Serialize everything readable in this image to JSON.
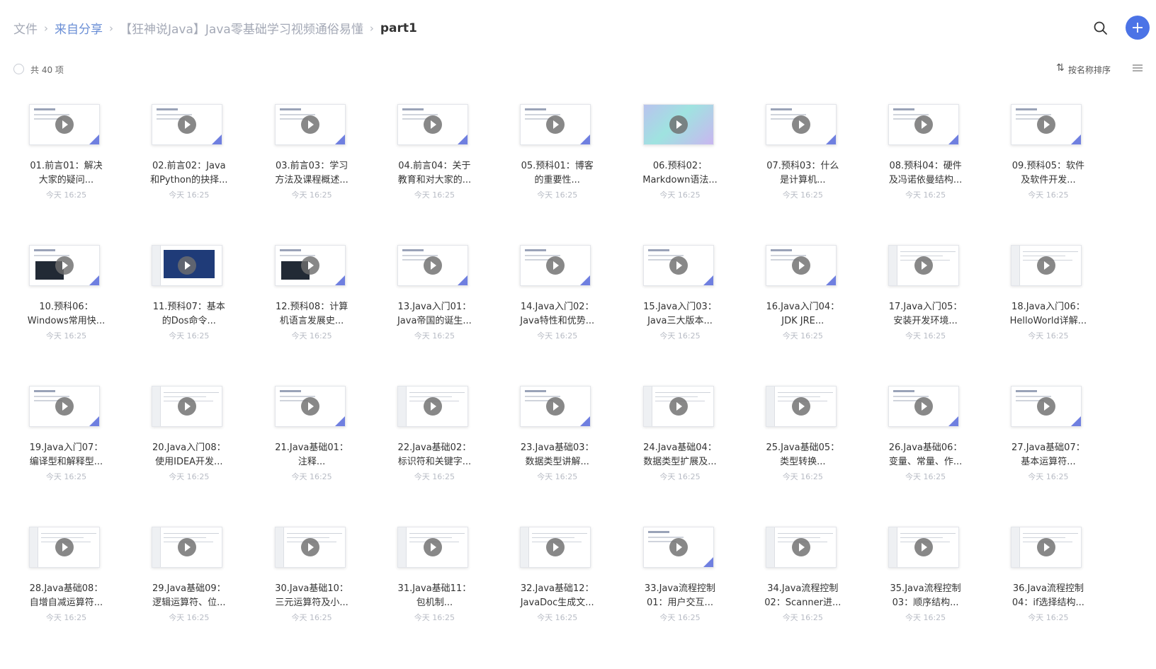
{
  "breadcrumb": [
    "文件",
    "来自分享",
    "【狂神说Java】Java零基础学习视频通俗易懂",
    "part1"
  ],
  "toolbar": {
    "search_icon": "search-icon",
    "add_icon": "plus-icon",
    "add_label": "+"
  },
  "subbar": {
    "count": "共 40 项",
    "sort_label": "按名称排序",
    "sort_icon": "⇅"
  },
  "files": [
    {
      "line1": "01.前言01：解决",
      "line2": "大家的疑问...",
      "date": "今天 16:25",
      "thumb": "slide"
    },
    {
      "line1": "02.前言02：Java",
      "line2": "和Python的抉择...",
      "date": "今天 16:25",
      "thumb": "slide"
    },
    {
      "line1": "03.前言03：学习",
      "line2": "方法及课程概述...",
      "date": "今天 16:25",
      "thumb": "slide"
    },
    {
      "line1": "04.前言04：关于",
      "line2": "教育和对大家的...",
      "date": "今天 16:25",
      "thumb": "slide"
    },
    {
      "line1": "05.预科01：博客",
      "line2": "的重要性...",
      "date": "今天 16:25",
      "thumb": "slide"
    },
    {
      "line1": "06.预科02：",
      "line2": "Markdown语法...",
      "date": "今天 16:25",
      "thumb": "gradient"
    },
    {
      "line1": "07.预科03：什么",
      "line2": "是计算机...",
      "date": "今天 16:25",
      "thumb": "slide"
    },
    {
      "line1": "08.预科04：硬件",
      "line2": "及冯诺依曼结构...",
      "date": "今天 16:25",
      "thumb": "slide"
    },
    {
      "line1": "09.预科05：软件",
      "line2": "及软件开发...",
      "date": "今天 16:25",
      "thumb": "slide"
    },
    {
      "line1": "10.预科06：",
      "line2": "Windows常用快...",
      "date": "今天 16:25",
      "thumb": "dark"
    },
    {
      "line1": "11.预科07：基本",
      "line2": "的Dos命令...",
      "date": "今天 16:25",
      "thumb": "blue"
    },
    {
      "line1": "12.预科08：计算",
      "line2": "机语言发展史...",
      "date": "今天 16:25",
      "thumb": "dark"
    },
    {
      "line1": "13.Java入门01：",
      "line2": "Java帝国的诞生...",
      "date": "今天 16:25",
      "thumb": "slide"
    },
    {
      "line1": "14.Java入门02：",
      "line2": "Java特性和优势...",
      "date": "今天 16:25",
      "thumb": "slide"
    },
    {
      "line1": "15.Java入门03：",
      "line2": "Java三大版本...",
      "date": "今天 16:25",
      "thumb": "slide"
    },
    {
      "line1": "16.Java入门04：",
      "line2": "JDK JRE...",
      "date": "今天 16:25",
      "thumb": "slide"
    },
    {
      "line1": "17.Java入门05：",
      "line2": "安装开发环境...",
      "date": "今天 16:25",
      "thumb": "screen"
    },
    {
      "line1": "18.Java入门06：",
      "line2": "HelloWorld详解...",
      "date": "今天 16:25",
      "thumb": "screen"
    },
    {
      "line1": "19.Java入门07：",
      "line2": "编译型和解释型...",
      "date": "今天 16:25",
      "thumb": "slide"
    },
    {
      "line1": "20.Java入门08：",
      "line2": "使用IDEA开发...",
      "date": "今天 16:25",
      "thumb": "screen"
    },
    {
      "line1": "21.Java基础01：",
      "line2": "注释...",
      "date": "今天 16:25",
      "thumb": "slide"
    },
    {
      "line1": "22.Java基础02：",
      "line2": "标识符和关键字...",
      "date": "今天 16:25",
      "thumb": "screen"
    },
    {
      "line1": "23.Java基础03：",
      "line2": "数据类型讲解...",
      "date": "今天 16:25",
      "thumb": "slide"
    },
    {
      "line1": "24.Java基础04：",
      "line2": "数据类型扩展及...",
      "date": "今天 16:25",
      "thumb": "screen"
    },
    {
      "line1": "25.Java基础05：",
      "line2": "类型转换...",
      "date": "今天 16:25",
      "thumb": "screen"
    },
    {
      "line1": "26.Java基础06：",
      "line2": "变量、常量、作...",
      "date": "今天 16:25",
      "thumb": "slide"
    },
    {
      "line1": "27.Java基础07：",
      "line2": "基本运算符...",
      "date": "今天 16:25",
      "thumb": "slide"
    },
    {
      "line1": "28.Java基础08：",
      "line2": "自增自减运算符...",
      "date": "今天 16:25",
      "thumb": "screen"
    },
    {
      "line1": "29.Java基础09：",
      "line2": "逻辑运算符、位...",
      "date": "今天 16:25",
      "thumb": "screen"
    },
    {
      "line1": "30.Java基础10：",
      "line2": "三元运算符及小...",
      "date": "今天 16:25",
      "thumb": "screen"
    },
    {
      "line1": "31.Java基础11：",
      "line2": "包机制...",
      "date": "今天 16:25",
      "thumb": "screen"
    },
    {
      "line1": "32.Java基础12：",
      "line2": "JavaDoc生成文...",
      "date": "今天 16:25",
      "thumb": "screen"
    },
    {
      "line1": "33.Java流程控制",
      "line2": "01：用户交互...",
      "date": "今天 16:25",
      "thumb": "slide"
    },
    {
      "line1": "34.Java流程控制",
      "line2": "02：Scanner进...",
      "date": "今天 16:25",
      "thumb": "screen"
    },
    {
      "line1": "35.Java流程控制",
      "line2": "03：顺序结构...",
      "date": "今天 16:25",
      "thumb": "screen"
    },
    {
      "line1": "36.Java流程控制",
      "line2": "04：if选择结构...",
      "date": "今天 16:25",
      "thumb": "screen"
    }
  ]
}
